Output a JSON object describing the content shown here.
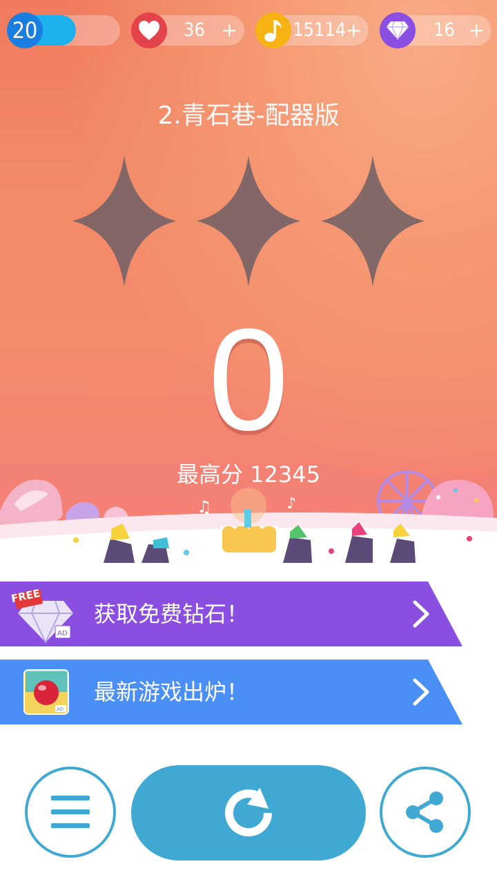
{
  "status_bar": {
    "level": "20",
    "level_progress": 0.6,
    "hearts": "36",
    "notes": "15114",
    "diamonds": "16",
    "plus": "+",
    "colors": {
      "level": "#1a7ee0",
      "heart": "#e4434c",
      "note": "#f7b314",
      "diamond": "#8a4ee0"
    }
  },
  "song": {
    "title": "2.青石巷-配器版"
  },
  "result": {
    "stars_earned": 0,
    "stars_total": 3,
    "score": "0",
    "best_label": "最高分 12345"
  },
  "offers": [
    {
      "label": "获取免费钻石！",
      "badge": "FREE",
      "icon": "diamond-ad-icon",
      "color": "#8a4fe0"
    },
    {
      "label": "最新游戏出炉！",
      "icon": "ball-game-ad-icon",
      "color": "#4a8ff5"
    }
  ],
  "actions": {
    "menu_icon": "menu-icon",
    "replay_icon": "replay-icon",
    "share_icon": "share-icon",
    "accent": "#40a9d3"
  }
}
